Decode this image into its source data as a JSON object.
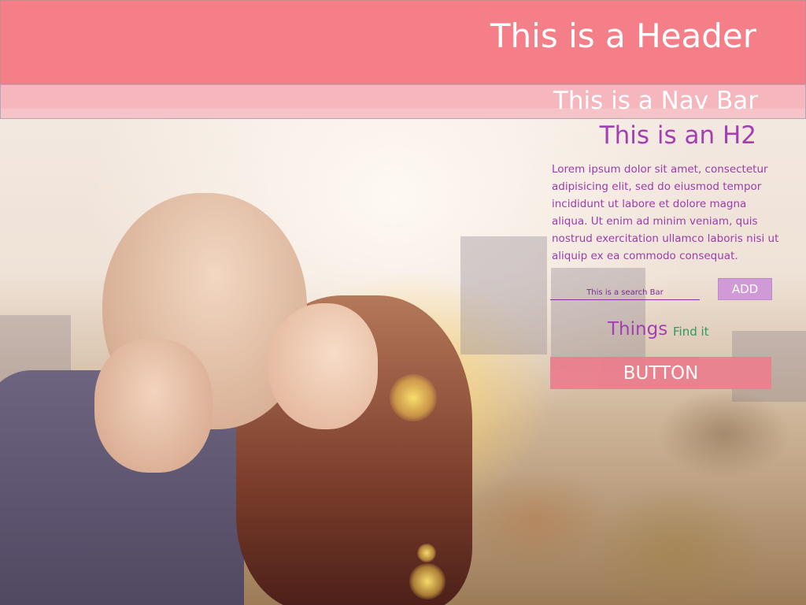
{
  "header": {
    "title": "This is a Header"
  },
  "navbar": {
    "title": "This is a Nav Bar"
  },
  "content": {
    "h2": "This is an H2",
    "paragraph": "Lorem ipsum dolor sit amet, consectetur adipisicing elit, sed do eiusmod tempor incididunt ut labore et dolore magna aliqua. Ut enim ad minim veniam, quis nostrud exercitation ullamco laboris nisi ut aliquip ex ea commodo consequat.",
    "search": {
      "placeholder": "This is a search Bar"
    },
    "add_label": "ADD",
    "things_label": "Things",
    "find_label": "Find it",
    "button_label": "BUTTON"
  },
  "colors": {
    "header_bg": "#f47f88",
    "navbar_bg": "#f6b6be",
    "accent_purple": "#a33fb3",
    "link_green": "#2f9a5a",
    "button_bg": "#ea7f8d",
    "add_bg": "#cf9ad6"
  },
  "background": {
    "image": "couple-kissing-photo"
  }
}
